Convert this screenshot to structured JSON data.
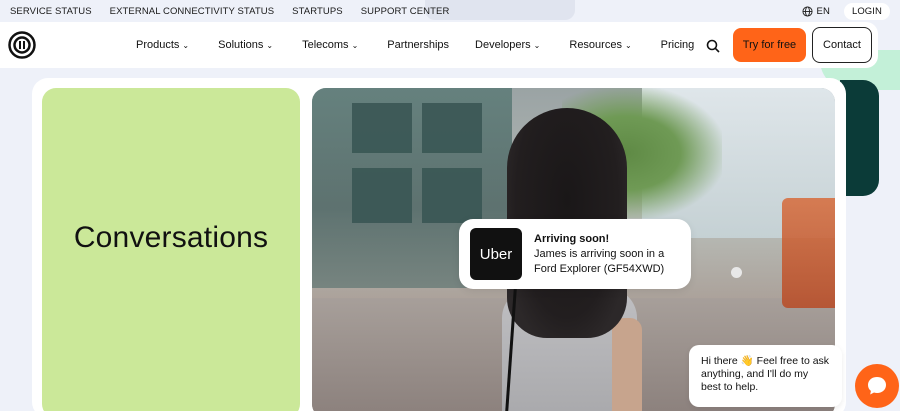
{
  "utility": {
    "links": [
      "SERVICE STATUS",
      "EXTERNAL CONNECTIVITY STATUS",
      "STARTUPS",
      "SUPPORT CENTER"
    ],
    "language": "EN",
    "login": "LOGIN"
  },
  "nav": {
    "items": [
      {
        "label": "Products",
        "dropdown": true
      },
      {
        "label": "Solutions",
        "dropdown": true
      },
      {
        "label": "Telecoms",
        "dropdown": true
      },
      {
        "label": "Partnerships",
        "dropdown": false
      },
      {
        "label": "Developers",
        "dropdown": true
      },
      {
        "label": "Resources",
        "dropdown": true
      },
      {
        "label": "Pricing",
        "dropdown": false
      }
    ],
    "try_label": "Try for free",
    "contact_label": "Contact"
  },
  "hero": {
    "card_title": "Conversations"
  },
  "notification": {
    "brand": "Uber",
    "title": "Arriving soon!",
    "body": "James is arriving soon in a Ford Explorer (GF54XWD)"
  },
  "chat": {
    "message": "Hi there 👋 Feel free to ask anything, and I'll do my best to help."
  },
  "colors": {
    "accent": "#ff6418",
    "card_green": "#cbe899",
    "dark_green": "#0b3b38"
  }
}
